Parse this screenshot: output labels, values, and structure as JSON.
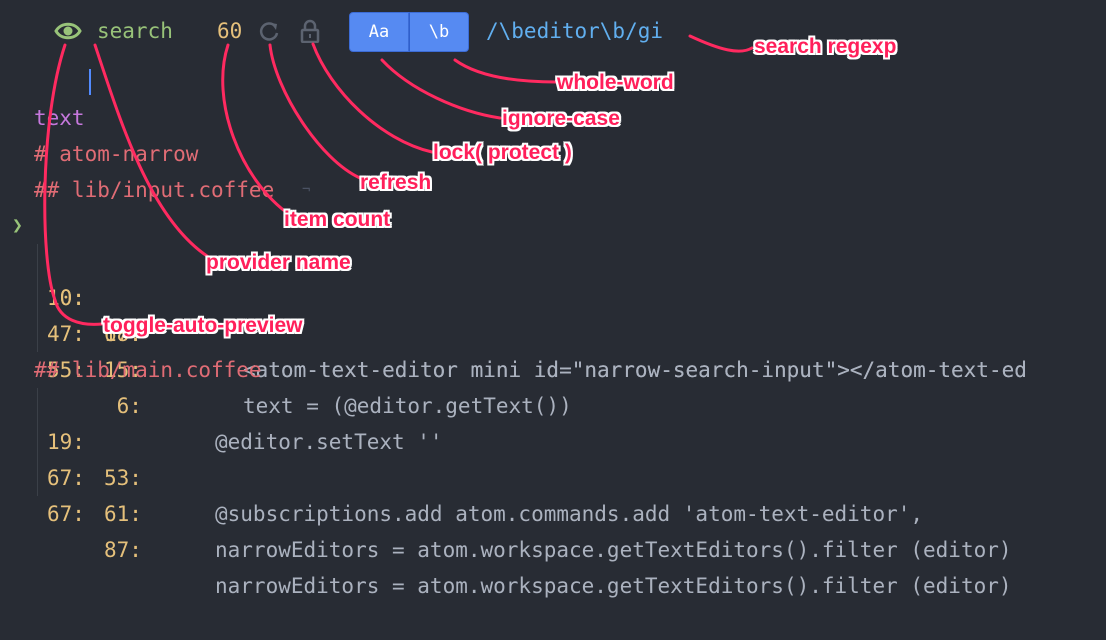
{
  "header": {
    "auto_preview_icon": "eye-icon",
    "provider_name": "search",
    "item_count": "60",
    "refresh_icon": "refresh-icon",
    "lock_icon": "lock-icon",
    "ignore_case_label": "Aa",
    "whole_word_label": "\\b",
    "search_regexp": "/\\beditor\\b/gi",
    "accent_color": "#568af2"
  },
  "editor": {
    "input_text": "text",
    "lines": [
      {
        "header": "# atom-narrow"
      },
      {
        "header": "## lib/input.coffee"
      },
      {
        "row": "10:",
        "col": "18:",
        "code": "<atom-text-editor mini id=\"narrow-search-input\"></atom-text-ed"
      },
      {
        "row": "10:",
        "col": "67:",
        "code": "<atom-text-editor mini id=\"narrow-search-input\"></atom-text-ed"
      },
      {
        "row": "47:",
        "col": "15:",
        "code": "text = (@editor.getText())"
      },
      {
        "row": "55:",
        "col": " 6:",
        "code": "@editor.setText ''"
      },
      {
        "header": "## lib/main.coffee"
      },
      {
        "row": "19:",
        "col": "53:",
        "code": "@subscriptions.add atom.commands.add 'atom-text-editor',"
      },
      {
        "row": "67:",
        "col": "61:",
        "code": "narrowEditors = atom.workspace.getTextEditors().filter (editor)"
      },
      {
        "row": "67:",
        "col": "87:",
        "code": "narrowEditors = atom.workspace.getTextEditors().filter (editor)"
      }
    ]
  },
  "annotations": {
    "search_regexp": "search regexp",
    "whole_word": "whole-word",
    "ignore_case": "ignore-case",
    "lock": "lock( protect )",
    "refresh": "refresh",
    "item_count": "item count",
    "provider_name": "provider name",
    "toggle_auto_preview": "toggle-auto-preview"
  }
}
